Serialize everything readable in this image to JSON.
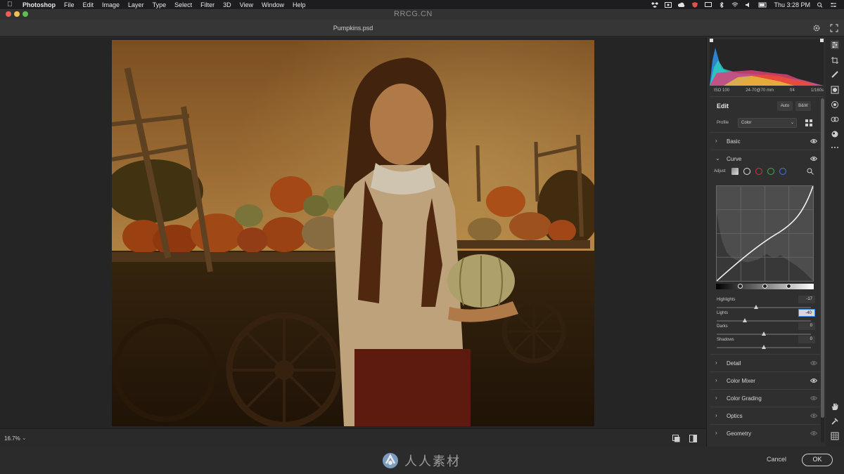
{
  "menubar": {
    "app_name": "Photoshop",
    "items": [
      "File",
      "Edit",
      "Image",
      "Layer",
      "Type",
      "Select",
      "Filter",
      "3D",
      "View",
      "Window",
      "Help"
    ],
    "clock": "Thu 3:28 PM"
  },
  "window": {
    "title": "RRCG.CN",
    "document_name": "Pumpkins.psd"
  },
  "status": {
    "zoom": "16.7%"
  },
  "panel": {
    "exif": [
      "ISO 100",
      "24-70@70 mm",
      "f/4",
      "1/160s"
    ],
    "edit_title": "Edit",
    "auto_label": "Auto",
    "bw_label": "B&W",
    "profile_label": "Profile",
    "profile_value": "Color",
    "sections_top": [
      {
        "label": "Basic",
        "expanded": false
      },
      {
        "label": "Curve",
        "expanded": true
      }
    ],
    "curve": {
      "adjust_label": "Adjust",
      "channels": [
        "parametric",
        "point",
        "red",
        "green",
        "blue"
      ],
      "sliders": [
        {
          "label": "Highlights",
          "value": "-17",
          "level": 0.42,
          "active": false
        },
        {
          "label": "Lights",
          "value": "-40",
          "level": 0.3,
          "active": true
        },
        {
          "label": "Darks",
          "value": "0",
          "level": 0.5,
          "active": false
        },
        {
          "label": "Shadows",
          "value": "0",
          "level": 0.5,
          "active": false
        }
      ]
    },
    "sections_bottom": [
      {
        "label": "Detail"
      },
      {
        "label": "Color Mixer"
      },
      {
        "label": "Color Grading"
      },
      {
        "label": "Optics"
      },
      {
        "label": "Geometry"
      }
    ]
  },
  "footer": {
    "brand_text": "人人素材",
    "cancel_label": "Cancel",
    "ok_label": "OK"
  },
  "colors": {
    "accent": "#3b8be6",
    "photo_tone": "#a0622a"
  }
}
